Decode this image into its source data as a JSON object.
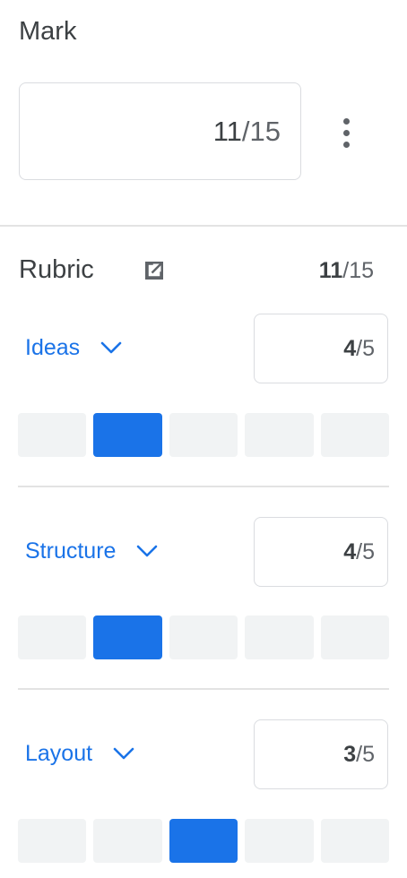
{
  "mark": {
    "title": "Mark",
    "score": "11",
    "separator": "/",
    "max": "15"
  },
  "more_options_icon": "more-vert-icon",
  "rubric": {
    "title": "Rubric",
    "open_icon": "open-in-new-icon",
    "total_score": "11",
    "total_separator": "/",
    "total_max": "15",
    "accent_color": "#1a73e8",
    "level_color": "#f1f3f4",
    "criteria": [
      {
        "name": "Ideas",
        "score": "4",
        "separator": "/",
        "max": "5",
        "selected_level": 2,
        "level_count": 5
      },
      {
        "name": "Structure",
        "score": "4",
        "separator": "/",
        "max": "5",
        "selected_level": 2,
        "level_count": 5
      },
      {
        "name": "Layout",
        "score": "3",
        "separator": "/",
        "max": "5",
        "selected_level": 3,
        "level_count": 5
      }
    ]
  }
}
